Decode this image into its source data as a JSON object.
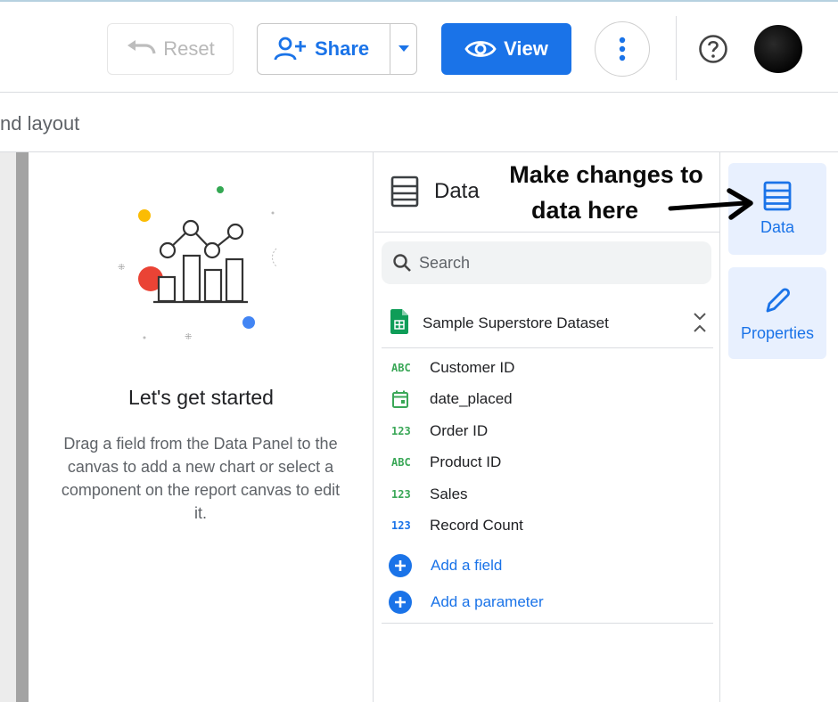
{
  "toolbar": {
    "reset_label": "Reset",
    "share_label": "Share",
    "view_label": "View"
  },
  "subbar": {
    "layout_text": "nd layout"
  },
  "empty_state": {
    "title": "Let's get started",
    "description": "Drag a field from the Data Panel to the canvas to add a new chart or select a component on the report canvas to edit it."
  },
  "data_panel": {
    "title": "Data",
    "search_placeholder": "Search",
    "source_name": "Sample Superstore Dataset",
    "fields": [
      {
        "type_label": "ABC",
        "kind": "dimension",
        "name": "Customer ID"
      },
      {
        "type_label": "",
        "kind": "date",
        "name": "date_placed"
      },
      {
        "type_label": "123",
        "kind": "dimension",
        "name": "Order ID"
      },
      {
        "type_label": "ABC",
        "kind": "dimension",
        "name": "Product ID"
      },
      {
        "type_label": "123",
        "kind": "dimension",
        "name": "Sales"
      },
      {
        "type_label": "123",
        "kind": "metric",
        "name": "Record Count"
      }
    ],
    "add_field_label": "Add a field",
    "add_parameter_label": "Add a parameter"
  },
  "side_tabs": {
    "data_label": "Data",
    "properties_label": "Properties"
  },
  "annotation": {
    "line1": "Make changes to",
    "line2": "data here"
  },
  "colors": {
    "accent": "#1a73e8",
    "dimension": "#3aa757",
    "tab_bg": "#e8f0fe"
  },
  "icons": {
    "reset": "undo-icon",
    "share": "add-person-icon",
    "view": "eye-icon",
    "more": "vertical-dots-icon",
    "help": "help-circle-icon",
    "data": "table-rows-icon",
    "properties": "pencil-icon",
    "search": "search-icon",
    "source": "sheets-icon"
  }
}
